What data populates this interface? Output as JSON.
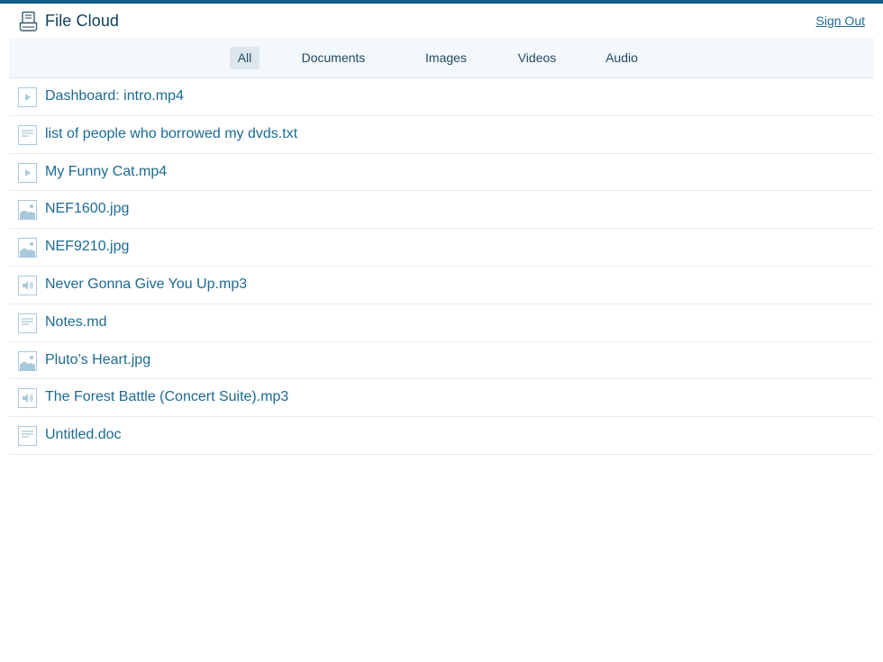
{
  "header": {
    "title": "File Cloud",
    "logo_icon": "cloud-drive-icon",
    "sign_out_label": "Sign Out"
  },
  "filters": {
    "tabs": [
      {
        "label": "All",
        "active": true
      },
      {
        "label": "Documents",
        "active": false
      },
      {
        "label": "Images",
        "active": false
      },
      {
        "label": "Videos",
        "active": false
      },
      {
        "label": "Audio",
        "active": false
      }
    ]
  },
  "files": [
    {
      "name": "Dashboard: intro.mp4",
      "type": "video",
      "icon": "video-file-icon"
    },
    {
      "name": "list of people who borrowed my dvds.txt",
      "type": "document",
      "icon": "document-file-icon"
    },
    {
      "name": "My Funny Cat.mp4",
      "type": "video",
      "icon": "video-file-icon"
    },
    {
      "name": "NEF1600.jpg",
      "type": "image",
      "icon": "image-file-icon"
    },
    {
      "name": "NEF9210.jpg",
      "type": "image",
      "icon": "image-file-icon"
    },
    {
      "name": "Never Gonna Give You Up.mp3",
      "type": "audio",
      "icon": "audio-file-icon"
    },
    {
      "name": "Notes.md",
      "type": "document",
      "icon": "document-file-icon"
    },
    {
      "name": "Pluto’s Heart.jpg",
      "type": "image",
      "icon": "image-file-icon"
    },
    {
      "name": "The Forest Battle (Concert Suite).mp3",
      "type": "audio",
      "icon": "audio-file-icon"
    },
    {
      "name": "Untitled.doc",
      "type": "document",
      "icon": "document-file-icon"
    }
  ],
  "colors": {
    "accent": "#0f5f86",
    "link": "#1c6a93",
    "filterbar_bg": "#f2f8fb",
    "active_tab_bg": "#dde6ec"
  }
}
